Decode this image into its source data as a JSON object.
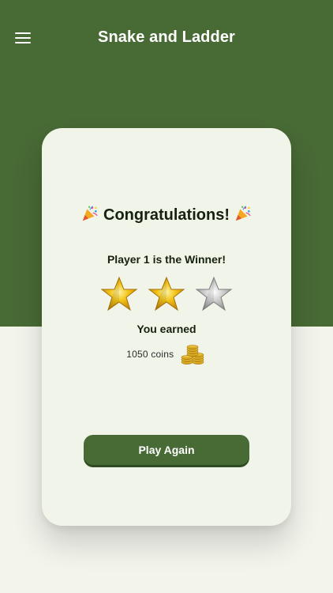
{
  "header": {
    "title": "Snake and Ladder",
    "menu_icon": "hamburger-menu-icon"
  },
  "result": {
    "congrats": "Congratulations!",
    "celebration_icon": "party-popper-icon",
    "winner_text": "Player 1 is the Winner!",
    "stars_earned": 2,
    "stars_total": 3,
    "earned_label": "You earned",
    "coins_text": "1050 coins",
    "coin_icon": "coin-stack-icon"
  },
  "actions": {
    "play_again_label": "Play Again"
  },
  "colors": {
    "brand_green": "#486a35",
    "card_background": "#f1f4e8",
    "page_background": "#f3f4ec",
    "gold_star": "#f2c418",
    "silver_star": "#b9b9b9"
  }
}
